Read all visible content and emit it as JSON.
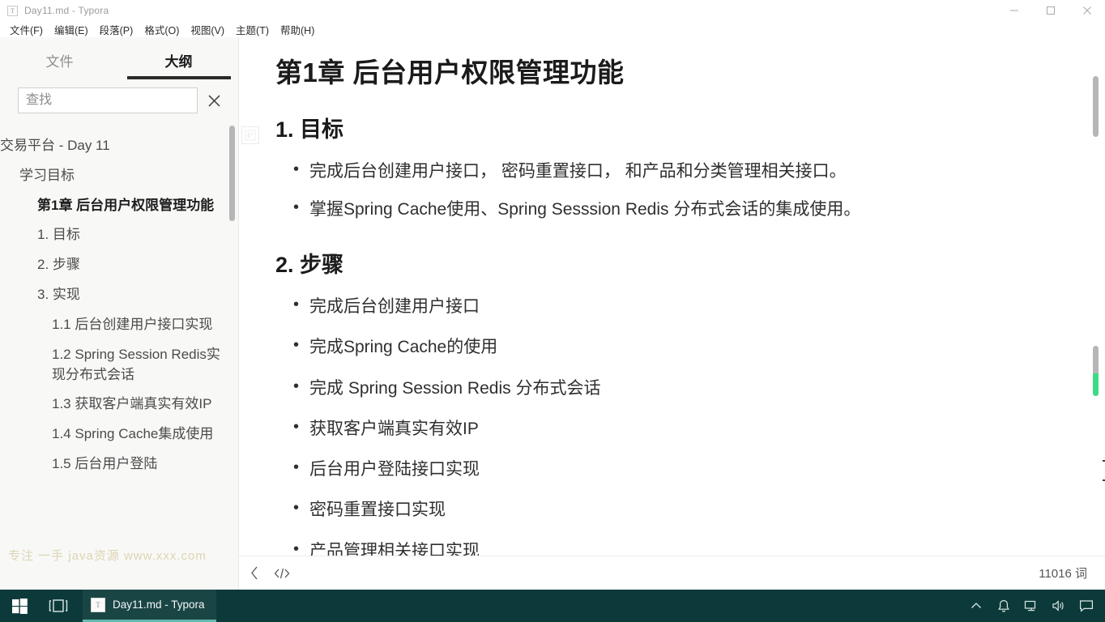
{
  "window": {
    "title": "Day11.md - Typora",
    "app_icon": "typora-document-icon",
    "controls": {
      "minimize": "minimize-icon",
      "maximize": "maximize-icon",
      "close": "close-icon"
    }
  },
  "menubar": {
    "items": [
      {
        "label": "文件(F)"
      },
      {
        "label": "编辑(E)"
      },
      {
        "label": "段落(P)"
      },
      {
        "label": "格式(O)"
      },
      {
        "label": "视图(V)"
      },
      {
        "label": "主题(T)"
      },
      {
        "label": "帮助(H)"
      }
    ]
  },
  "sidebar": {
    "tabs": [
      {
        "label": "文件",
        "active": false
      },
      {
        "label": "大纲",
        "active": true
      }
    ],
    "search": {
      "placeholder": "查找",
      "value": "",
      "close_icon": "close-icon"
    },
    "outline": [
      {
        "label": "交易平台 - Day 11",
        "level": 0,
        "strong": false
      },
      {
        "label": "学习目标",
        "level": 1,
        "strong": false
      },
      {
        "label": "第1章 后台用户权限管理功能",
        "level": 2,
        "strong": true
      },
      {
        "label": "1. 目标",
        "level": 2,
        "strong": false
      },
      {
        "label": "2. 步骤",
        "level": 2,
        "strong": false
      },
      {
        "label": "3. 实现",
        "level": 2,
        "strong": false
      },
      {
        "label": "1.1 后台创建用户接口实现",
        "level": 3,
        "strong": false
      },
      {
        "label": "1.2 Spring Session Redis实现分布式会话",
        "level": 3,
        "strong": false
      },
      {
        "label": "1.3 获取客户端真实有效IP",
        "level": 3,
        "strong": false
      },
      {
        "label": "1.4 Spring Cache集成使用",
        "level": 3,
        "strong": false
      },
      {
        "label": "1.5 后台用户登陆",
        "level": 3,
        "strong": false
      }
    ],
    "watermark": "专注 一手 java资源 www.xxx.com"
  },
  "document": {
    "h1": "第1章 后台用户权限管理功能",
    "section_goal": {
      "heading": "1. 目标",
      "bullets": [
        "完成后台创建用户接口， 密码重置接口， 和产品和分类管理相关接口。",
        "掌握Spring Cache使用、Spring Sesssion Redis 分布式会话的集成使用。"
      ]
    },
    "section_steps": {
      "heading": "2. 步骤",
      "bullets": [
        "完成后台创建用户接口",
        "完成Spring Cache的使用",
        "完成 Spring Session Redis 分布式会话",
        "获取客户端真实有效IP",
        "后台用户登陆接口实现",
        "密码重置接口实现",
        "产品管理相关接口实现"
      ]
    },
    "heading_anchor_icon": "outline-marker-icon"
  },
  "statusbar": {
    "back_icon": "chevron-left-icon",
    "source_code_icon": "source-code-icon",
    "word_count": "11016 词"
  },
  "taskbar": {
    "start_icon": "windows-start-icon",
    "taskview_icon": "task-view-icon",
    "active_window": {
      "icon": "typora-document-icon",
      "label": "Day11.md - Typora"
    },
    "tray": [
      {
        "icon": "chevron-up-icon"
      },
      {
        "icon": "bell-icon"
      },
      {
        "icon": "network-icon"
      },
      {
        "icon": "volume-icon"
      },
      {
        "icon": "action-center-icon"
      }
    ]
  },
  "colors": {
    "taskbar_bg": "#0c3a3a",
    "tab_underline": "#2b2b2b",
    "scroll_progress": "#3ddc84",
    "task_accent": "#63b8b0"
  }
}
